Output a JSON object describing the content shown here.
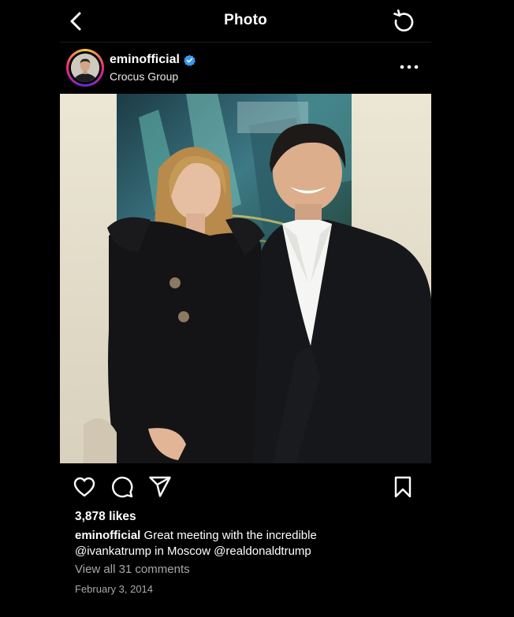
{
  "topbar": {
    "title": "Photo"
  },
  "post": {
    "username": "eminofficial",
    "verified": true,
    "location": "Crocus Group",
    "likes": "3,878 likes",
    "caption": {
      "user": "eminofficial",
      "text_1": " Great meeting with the incredible",
      "mention_1": "@ivankatrump",
      "text_2": " in Moscow ",
      "mention_2": "@realdonaldtrump"
    },
    "comments_link": "View all 31 comments",
    "date": "February 3, 2014"
  },
  "icons": {
    "back": "chevron-left-icon",
    "refresh": "refresh-icon",
    "verified": "verified-badge-icon",
    "more": "more-horizontal-icon",
    "like": "heart-icon",
    "comment": "comment-icon",
    "share": "send-icon",
    "save": "bookmark-icon"
  },
  "colors": {
    "background": "#000000",
    "verified": "#3897f0",
    "muted": "#a8a8a8"
  }
}
